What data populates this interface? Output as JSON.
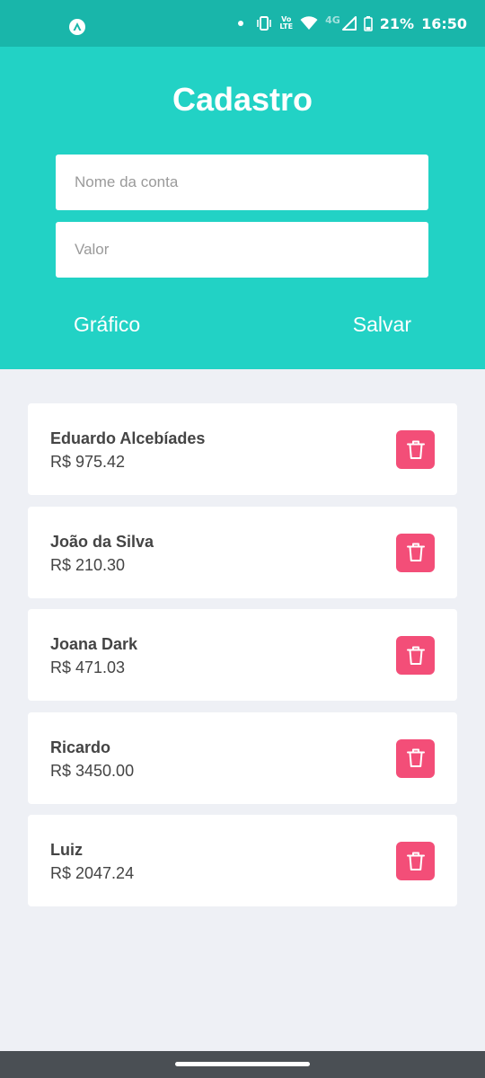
{
  "status_bar": {
    "network_type": "4G",
    "volte_top": "Vo",
    "volte_bottom": "LTE",
    "battery": "21%",
    "time": "16:50"
  },
  "header": {
    "title": "Cadastro",
    "name_placeholder": "Nome da conta",
    "value_placeholder": "Valor",
    "chart_button": "Gráfico",
    "save_button": "Salvar",
    "color": "#22d2c5"
  },
  "accounts": [
    {
      "name": "Eduardo Alcebíades",
      "value": "R$ 975.42"
    },
    {
      "name": "João da Silva",
      "value": "R$ 210.30"
    },
    {
      "name": "Joana Dark",
      "value": "R$ 471.03"
    },
    {
      "name": "Ricardo",
      "value": "R$ 3450.00"
    },
    {
      "name": "Luiz",
      "value": "R$ 2047.24"
    }
  ],
  "icons": {
    "delete": "trash-icon"
  },
  "colors": {
    "delete_button": "#f34e78",
    "background": "#eef0f5"
  }
}
